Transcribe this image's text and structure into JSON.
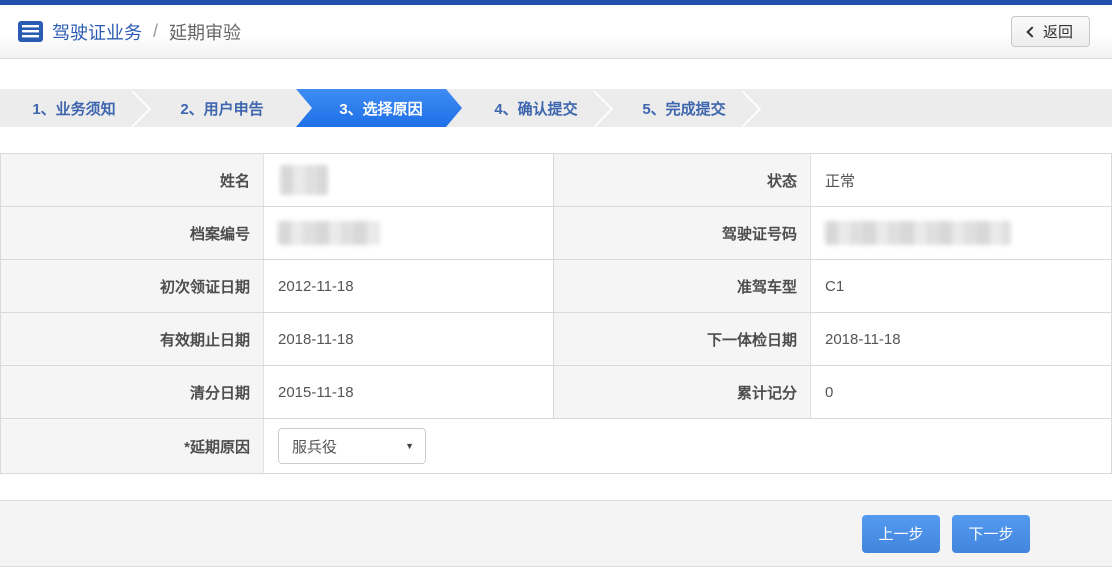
{
  "header": {
    "title_primary": "驾驶证业务",
    "separator": "/",
    "title_secondary": "延期审验",
    "back_label": "返回"
  },
  "steps": [
    {
      "label": "1、业务须知",
      "active": false
    },
    {
      "label": "2、用户申告",
      "active": false
    },
    {
      "label": "3、选择原因",
      "active": true
    },
    {
      "label": "4、确认提交",
      "active": false
    },
    {
      "label": "5、完成提交",
      "active": false
    }
  ],
  "form": {
    "rows": [
      {
        "left_label": "姓名",
        "left_value": "",
        "left_masked": true,
        "right_label": "状态",
        "right_value": "正常",
        "right_masked": false
      },
      {
        "left_label": "档案编号",
        "left_value": "",
        "left_masked": true,
        "right_label": "驾驶证号码",
        "right_value": "",
        "right_masked": true
      },
      {
        "left_label": "初次领证日期",
        "left_value": "2012-11-18",
        "left_masked": false,
        "right_label": "准驾车型",
        "right_value": "C1",
        "right_masked": false
      },
      {
        "left_label": "有效期止日期",
        "left_value": "2018-11-18",
        "left_masked": false,
        "right_label": "下一体检日期",
        "right_value": "2018-11-18",
        "right_masked": false
      },
      {
        "left_label": "清分日期",
        "left_value": "2015-11-18",
        "left_masked": false,
        "right_label": "累计记分",
        "right_value": "0",
        "right_masked": false
      }
    ],
    "reason_label": "*延期原因",
    "reason_selected": "服兵役",
    "dropdown_arrow": "▼"
  },
  "footer": {
    "prev_label": "上一步",
    "next_label": "下一步"
  },
  "icons": {
    "header_icon": "list-icon",
    "back_icon": "chevron-left-icon",
    "select_icon": "caret-down-icon"
  },
  "colors": {
    "top_accent": "#2150ae",
    "active_step_blue": "#2878ee",
    "step_text_blue": "#3e66ae",
    "title_blue": "#2b5cb4",
    "button_blue": "#4a90e2",
    "label_bg": "#f5f5f5",
    "bar_bg": "#ececec",
    "border": "#d9d9d9"
  }
}
